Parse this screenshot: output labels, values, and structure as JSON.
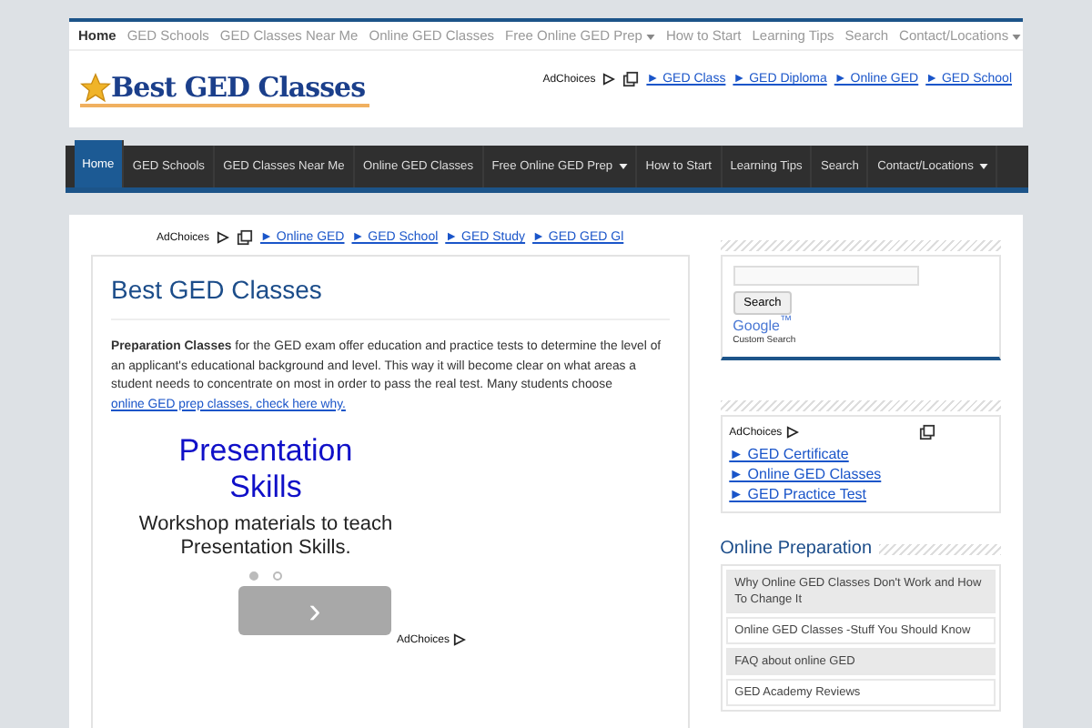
{
  "top_nav": [
    {
      "label": "Home",
      "selected": true,
      "dropdown": false
    },
    {
      "label": "GED Schools",
      "selected": false,
      "dropdown": false
    },
    {
      "label": "GED Classes Near Me",
      "selected": false,
      "dropdown": false
    },
    {
      "label": "Online GED Classes",
      "selected": false,
      "dropdown": false
    },
    {
      "label": "Free Online GED Prep",
      "selected": false,
      "dropdown": true
    },
    {
      "label": "How to Start",
      "selected": false,
      "dropdown": false
    },
    {
      "label": "Learning Tips",
      "selected": false,
      "dropdown": false
    },
    {
      "label": "Search",
      "selected": false,
      "dropdown": false
    },
    {
      "label": "Contact/Locations",
      "selected": false,
      "dropdown": true
    }
  ],
  "logo": {
    "text": "Best GED Classes"
  },
  "header_ad": {
    "label": "AdChoices",
    "links": [
      "► GED Class",
      "► GED Diploma",
      "► Online GED",
      "► GED School"
    ]
  },
  "main_nav": [
    {
      "label": "Home",
      "selected": true,
      "dropdown": false
    },
    {
      "label": "GED Schools",
      "selected": false,
      "dropdown": false
    },
    {
      "label": "GED Classes Near Me",
      "selected": false,
      "dropdown": false
    },
    {
      "label": "Online GED Classes",
      "selected": false,
      "dropdown": false
    },
    {
      "label": "Free Online GED Prep",
      "selected": false,
      "dropdown": true
    },
    {
      "label": "How to Start",
      "selected": false,
      "dropdown": false
    },
    {
      "label": "Learning Tips",
      "selected": false,
      "dropdown": false
    },
    {
      "label": "Search",
      "selected": false,
      "dropdown": false
    },
    {
      "label": "Contact/Locations",
      "selected": false,
      "dropdown": true
    }
  ],
  "content_ad": {
    "label": "AdChoices",
    "links": [
      "► Online GED",
      "► GED School",
      "► GED Study",
      "► GED GED Gl"
    ]
  },
  "article": {
    "title": "Best GED Classes",
    "body": "**Preparation Classes** for the GED exam offer education and practice tests to determine the level of an applicant's educational background and level. This way it will become clear on what areas a student needs to concentrate on most in order to pass the real test. Many students choose",
    "link": "online GED prep classes, check here why."
  },
  "ad_banner": {
    "title": "Presentation Skills",
    "text": "Workshop materials to teach Presentation Skills.",
    "dots": [
      {
        "selected": true
      },
      {
        "selected": false
      }
    ],
    "next": "›",
    "label": "AdChoices"
  },
  "sidebar": {
    "search": {
      "button": "Search",
      "brand": "Google$^{™}$",
      "caption": "Custom Search"
    },
    "ad": {
      "label": "AdChoices",
      "links": [
        "► GED Certificate",
        "► Online GED Classes",
        "► GED Practice Test"
      ]
    },
    "section_title": "Online Preparation",
    "posts": [
      "Why Online GED Classes Don't Work and How To Change It",
      "Online GED Classes -Stuff You Should Know",
      "FAQ about online GED",
      "GED Academy Reviews"
    ]
  }
}
